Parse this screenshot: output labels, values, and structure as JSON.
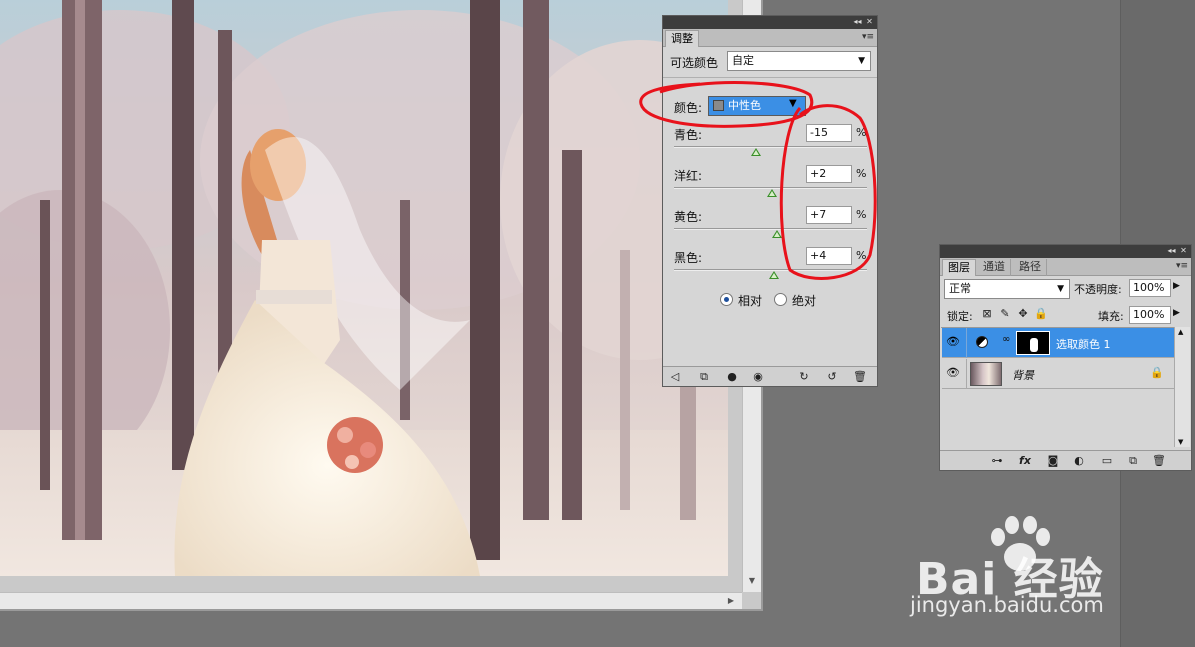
{
  "adjustments_panel": {
    "tab_label": "调整",
    "title": "可选颜色",
    "preset_value": "自定",
    "colors_label": "颜色:",
    "colors_value": "中性色",
    "sliders": [
      {
        "label": "青色:",
        "value": "-15",
        "unit": "%",
        "level": -15
      },
      {
        "label": "洋红:",
        "value": "+2",
        "unit": "%",
        "level": 2
      },
      {
        "label": "黄色:",
        "value": "+7",
        "unit": "%",
        "level": 7
      },
      {
        "label": "黑色:",
        "value": "+4",
        "unit": "%",
        "level": 4
      }
    ],
    "method_options": [
      {
        "label": "相对",
        "selected": true
      },
      {
        "label": "绝对",
        "selected": false
      }
    ]
  },
  "layers_panel": {
    "tabs": [
      "图层",
      "通道",
      "路径"
    ],
    "blend_mode": "正常",
    "opacity_label": "不透明度:",
    "opacity_value": "100%",
    "lock_label": "锁定:",
    "fill_label": "填充:",
    "fill_value": "100%",
    "layers": [
      {
        "name": "选取颜色 1",
        "selected": true,
        "type": "adjustment"
      },
      {
        "name": "背景",
        "selected": false,
        "type": "background",
        "locked": true
      }
    ]
  },
  "watermark": {
    "brand": "Bai  经验",
    "url": "jingyan.baidu.com"
  },
  "colors": {
    "annotation": "#e8121b",
    "selection": "#3b8fe5"
  }
}
